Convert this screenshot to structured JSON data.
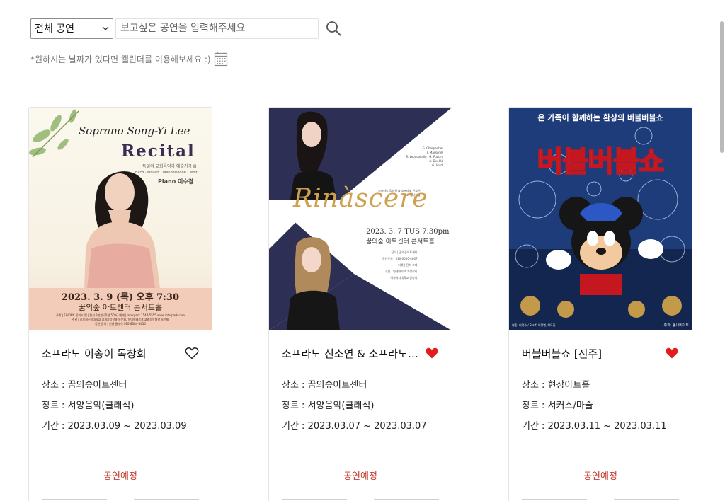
{
  "search": {
    "category_selected": "전체 공연",
    "placeholder": "보고싶은 공연을 입력해주세요"
  },
  "calendar_hint": "*원하시는 날짜가 있다면 캘린더를 이용해보세요 :)",
  "colors": {
    "status": "#c0392b",
    "heart_liked": "#e11d1d",
    "accent_gold": "#cfa04f"
  },
  "cards": [
    {
      "title": "소프라노 이송이 독창회",
      "venue": "장소 : 꿈의숲아트센터",
      "genre": "장르 : 서양음악(클래식)",
      "period": "기간 : 2023.03.09 ~ 2023.03.09",
      "status": "공연예정",
      "liked": false,
      "poster": {
        "name": "Soprano Song-Yi Lee",
        "headline": "Recital",
        "sub1": "독일의 교회음악과 예술가곡 Ⅲ",
        "sub2": "Bach · Mozart · Mendelssohn · Wolf",
        "piano": "Piano 이수경",
        "date": "2023. 3. 9 (목) 오후 7:30",
        "venue": "꿈의숲 아트센터 콘서트홀",
        "fine1": "주최 | FINDEN 문의 티켓 | 전석 3만원 (학생 50%) 예매 | interpark 1544-5555 www.interpark.com",
        "fine2": "주관 | 장로회신학대학교 교회음악학과 동문회, 하이델베르크 교회음악대학 동문회",
        "fine3": "공연 문의 | 핀덴 클래식 010-8384-5455"
      }
    },
    {
      "title": "소프라노 신소연 & 소프라노 김미연 듀오 리사이틀",
      "venue": "장소 : 꿈의숲아트센터",
      "genre": "장르 : 서양음악(클래식)",
      "period": "기간 : 2023.03.07 ~ 2023.03.07",
      "status": "공연예정",
      "liked": true,
      "poster": {
        "headline": "Rinàscere",
        "date": "2023. 3. 7 TUS 7:30pm",
        "venue": "꿈의숲 아트센터 콘서트홀",
        "composers": [
          "G. Charpentier",
          "J. Massenet",
          "R. Leoncavallo / G. Puccini",
          "A. Dvořák",
          "G. Verdi"
        ],
        "duo": "소프라노 김미연 & 소프라노 신소연",
        "duo2": "듀오 리사이틀",
        "credits": [
          "장소 | 꿈의숲아트센터",
          "공연문의 | 010-0000-4867",
          "티켓 | 전석 초대",
          "후원 | 연세대학교 가정학회",
          "이화여자대학교 동창회"
        ]
      }
    },
    {
      "title": "버블버블쇼 [진주]",
      "venue": "장소 : 현장아트홀",
      "genre": "장르 : 서커스/마술",
      "period": "기간 : 2023.03.11 ~ 2023.03.11",
      "status": "공연예정",
      "liked": true,
      "poster": {
        "headline": "온 가족이 함께하는 환상의 버블버블쇼",
        "big": "버블버블쇼",
        "foot_left": "연출: 이정수 / Staff: 이정열, 허도중",
        "foot_right": "주최: 봉나비아트"
      }
    }
  ]
}
